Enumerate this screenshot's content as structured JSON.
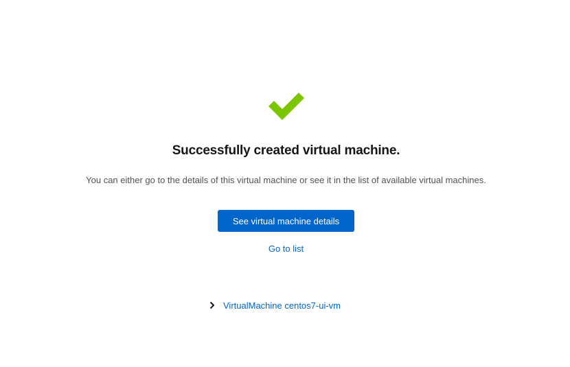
{
  "status": {
    "icon": "check-icon",
    "color": "#7cc600",
    "title": "Successfully created virtual machine.",
    "description": "You can either go to the details of this virtual machine or see it in the list of available virtual machines."
  },
  "actions": {
    "primary_label": "See virtual machine details",
    "primary_color": "#0066cc",
    "secondary_label": "Go to list"
  },
  "resource": {
    "expand_icon": "chevron-right-icon",
    "label": "VirtualMachine centos7-ui-vm"
  }
}
